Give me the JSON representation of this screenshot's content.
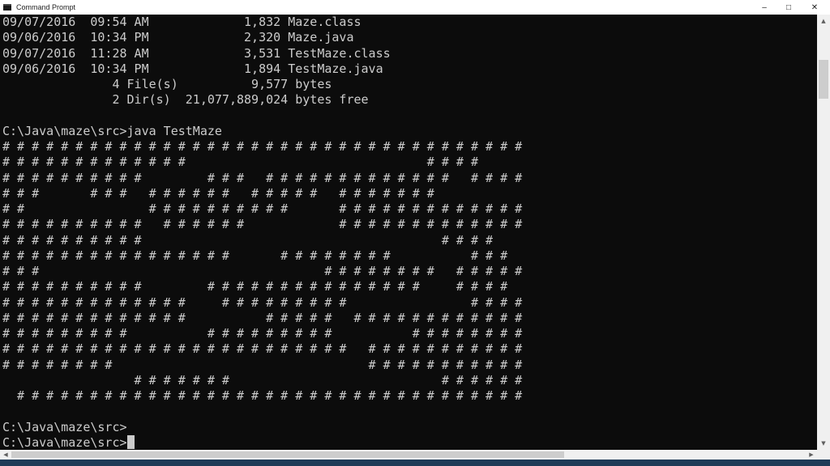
{
  "window": {
    "title": "Command Prompt",
    "minimize_glyph": "–",
    "maximize_glyph": "□",
    "close_glyph": "✕"
  },
  "console": {
    "lines": [
      "09/07/2016  09:54 AM             1,832 Maze.class",
      "09/06/2016  10:34 PM             2,320 Maze.java",
      "09/07/2016  11:28 AM             3,531 TestMaze.class",
      "09/06/2016  10:34 PM             1,894 TestMaze.java",
      "               4 File(s)          9,577 bytes",
      "               2 Dir(s)  21,077,889,024 bytes free",
      "",
      "C:\\Java\\maze\\src>java TestMaze",
      "# # # # # # # # # # # # # # # # # # # # # # # # # # # # # # # # # # # #",
      "# # # # # # # # # # # # #                                 # # # #",
      "# # # # # # # # # #         # # #   # # # # # # # # # # # # #   # # # #",
      "# # #       # # #   # # # # # #   # # # # #   # # # # # # #",
      "# #                 # # # # # # # # # #       # # # # # # # # # # # # #",
      "# # # # # # # # # #   # # # # # #             # # # # # # # # # # # # #",
      "# # # # # # # # # #                                         # # # #",
      "# # # # # # # # # # # # # # # #       # # # # # # # #           # # #",
      "# # #                                       # # # # # # # #   # # # # #",
      "# # # # # # # # # #         # # # # # # # # # # # # # # #     # # # #",
      "# # # # # # # # # # # # #     # # # # # # # # #                 # # # #",
      "# # # # # # # # # # # # #           # # # # #   # # # # # # # # # # # #",
      "# # # # # # # # #           # # # # # # # # #           # # # # # # # #",
      "# # # # # # # # # # # # # # # # # # # # # # # #   # # # # # # # # # # #",
      "# # # # # # # #                                   # # # # # # # # # # #",
      "                  # # # # # # #                             # # # # # #",
      "  # # # # # # # # # # # # # # # # # # # # # # # # # # # # # # # # # # #",
      "",
      "C:\\Java\\maze\\src>",
      "C:\\Java\\maze\\src>"
    ]
  },
  "scrollbar": {
    "up_glyph": "▲",
    "down_glyph": "▼",
    "left_glyph": "◀",
    "right_glyph": "▶"
  },
  "colors": {
    "background": "#0c0c0c",
    "foreground": "#cccccc"
  }
}
